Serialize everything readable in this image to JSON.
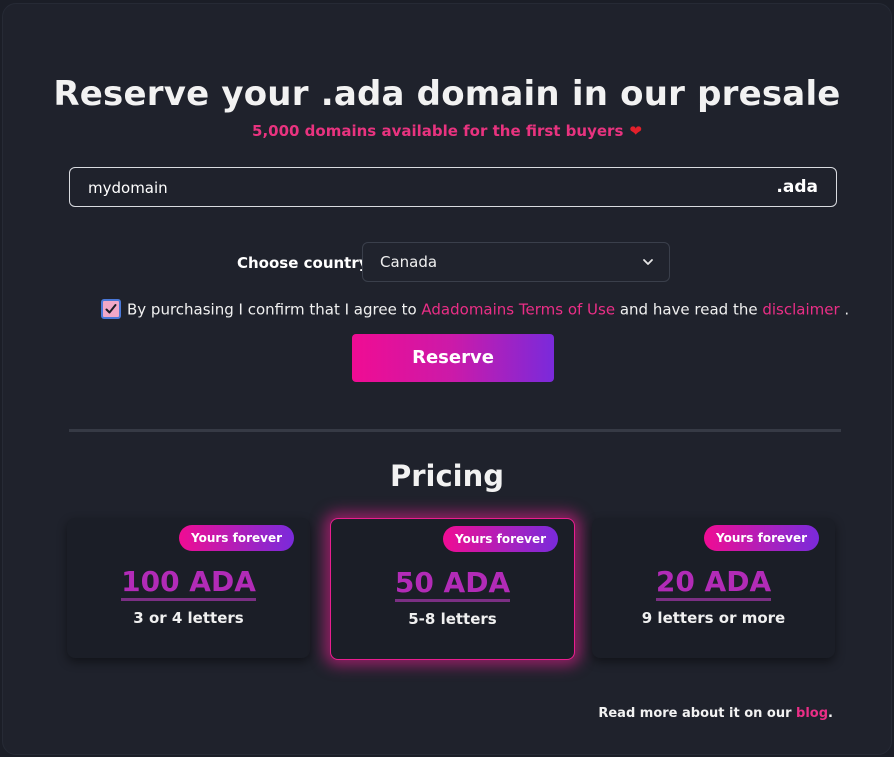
{
  "header": {
    "title": "Reserve your .ada domain in our presale",
    "subtitle": "5,000 domains available for the first buyers",
    "heart": "❤"
  },
  "domain": {
    "value": "mydomain",
    "suffix": ".ada"
  },
  "country": {
    "label": "Choose country",
    "selected": "Canada"
  },
  "agreement": {
    "checked": true,
    "text_before": "By purchasing I confirm that I agree to ",
    "terms_link": "Adadomains Terms of Use",
    "text_middle": " and have read the ",
    "disclaimer_link": "disclaimer",
    "text_after": " ."
  },
  "reserve_button": "Reserve",
  "pricing": {
    "title": "Pricing",
    "plans": [
      {
        "badge": "Yours forever",
        "price": "100 ADA",
        "letters": "3 or 4 letters"
      },
      {
        "badge": "Yours forever",
        "price": "50 ADA",
        "letters": "5-8 letters"
      },
      {
        "badge": "Yours forever",
        "price": "20 ADA",
        "letters": "9 letters or more"
      }
    ]
  },
  "footer": {
    "text": "Read more about it on our ",
    "link": "blog",
    "end": "."
  },
  "colors": {
    "accent_pink": "#ea2e86",
    "gradient_start": "#f00c93",
    "gradient_end": "#7a2adb",
    "price_purple": "#b22bb7",
    "background": "#1f222c"
  },
  "icons": {
    "select_caret": "chevron-down-icon",
    "checkbox_mark": "check-icon",
    "heart": "heart-icon"
  }
}
